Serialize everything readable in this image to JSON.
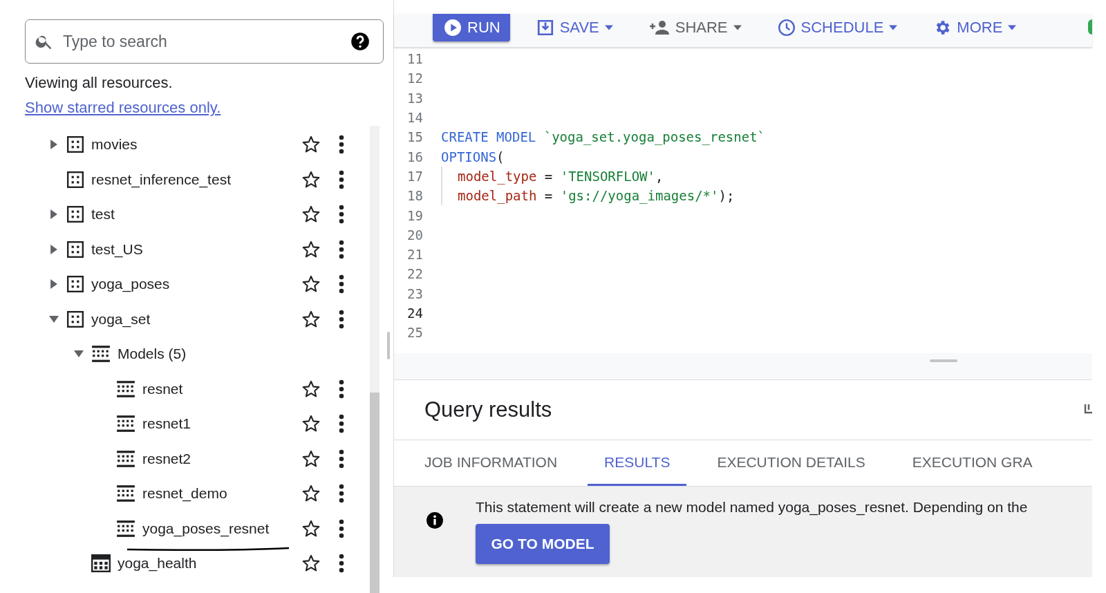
{
  "search": {
    "placeholder": "Type to search"
  },
  "viewing": {
    "text": "Viewing all resources.",
    "link": "Show starred resources only."
  },
  "tree": [
    {
      "name": "movies",
      "kind": "dataset",
      "expandable": true,
      "expanded": false,
      "underlined": false
    },
    {
      "name": "resnet_inference_test",
      "kind": "dataset",
      "expandable": false,
      "underlined": false
    },
    {
      "name": "test",
      "kind": "dataset",
      "expandable": true,
      "expanded": false,
      "underlined": false
    },
    {
      "name": "test_US",
      "kind": "dataset",
      "expandable": true,
      "expanded": false,
      "underlined": false
    },
    {
      "name": "yoga_poses",
      "kind": "dataset",
      "expandable": true,
      "expanded": false,
      "underlined": false
    },
    {
      "name": "yoga_set",
      "kind": "dataset",
      "expandable": true,
      "expanded": true,
      "underlined": false,
      "children": [
        {
          "name": "Models (5)",
          "kind": "folder",
          "expandable": true,
          "expanded": true,
          "underlined": false,
          "children": [
            {
              "name": "resnet",
              "kind": "model",
              "expandable": false,
              "underlined": false
            },
            {
              "name": "resnet1",
              "kind": "model",
              "expandable": false,
              "underlined": false
            },
            {
              "name": "resnet2",
              "kind": "model",
              "expandable": false,
              "underlined": false
            },
            {
              "name": "resnet_demo",
              "kind": "model",
              "expandable": false,
              "underlined": false
            },
            {
              "name": "yoga_poses_resnet",
              "kind": "model",
              "expandable": false,
              "underlined": true
            }
          ]
        },
        {
          "name": "yoga_health",
          "kind": "table",
          "expandable": false,
          "underlined": false
        }
      ]
    }
  ],
  "toolbar": [
    {
      "label": "RUN",
      "kind": "primary",
      "dropdown": false
    },
    {
      "label": "SAVE",
      "kind": "accent",
      "dropdown": true
    },
    {
      "label": "SHARE",
      "kind": "plain",
      "dropdown": true
    },
    {
      "label": "SCHEDULE",
      "kind": "accent",
      "dropdown": true
    },
    {
      "label": "MORE",
      "kind": "accent",
      "dropdown": true
    }
  ],
  "editor": {
    "lines": [
      {
        "number": "11",
        "indent": false,
        "current": false
      },
      {
        "number": "12",
        "indent": false,
        "current": false
      },
      {
        "number": "13",
        "indent": false,
        "current": false
      },
      {
        "number": "14",
        "indent": false,
        "current": false
      },
      {
        "number": "15",
        "indent": false,
        "current": false,
        "tokens": [
          {
            "text": "CREATE MODEL ",
            "kind": "keyword"
          },
          {
            "text": "`yoga_set.yoga_poses_resnet`",
            "kind": "string"
          }
        ]
      },
      {
        "number": "16",
        "indent": false,
        "current": false,
        "tokens": [
          {
            "text": "OPTIONS",
            "kind": "keyword"
          },
          {
            "text": "(",
            "kind": "punct"
          }
        ]
      },
      {
        "number": "17",
        "indent": true,
        "current": false,
        "tokens": [
          {
            "text": "model_type",
            "kind": "ident"
          },
          {
            "text": " = ",
            "kind": "punct"
          },
          {
            "text": "'TENSORFLOW'",
            "kind": "string"
          },
          {
            "text": ",",
            "kind": "punct"
          }
        ]
      },
      {
        "number": "18",
        "indent": true,
        "current": false,
        "tokens": [
          {
            "text": "model_path",
            "kind": "ident"
          },
          {
            "text": " = ",
            "kind": "punct"
          },
          {
            "text": "'gs://yoga_images/*'",
            "kind": "string"
          },
          {
            "text": ");",
            "kind": "punct"
          }
        ]
      },
      {
        "number": "19",
        "indent": false,
        "current": false
      },
      {
        "number": "20",
        "indent": false,
        "current": false
      },
      {
        "number": "21",
        "indent": false,
        "current": false
      },
      {
        "number": "22",
        "indent": false,
        "current": false
      },
      {
        "number": "23",
        "indent": false,
        "current": false
      },
      {
        "number": "24",
        "indent": false,
        "current": true
      },
      {
        "number": "25",
        "indent": false,
        "current": false
      }
    ]
  },
  "results": {
    "title": "Query results",
    "tabs": [
      {
        "label": "JOB INFORMATION",
        "selected": false
      },
      {
        "label": "RESULTS",
        "selected": true
      },
      {
        "label": "EXECUTION DETAILS",
        "selected": false
      },
      {
        "label": "EXECUTION GRA",
        "selected": false
      }
    ],
    "message": "This statement will create a new model named yoga_poses_resnet. Depending on the",
    "button": "GO TO MODEL"
  }
}
